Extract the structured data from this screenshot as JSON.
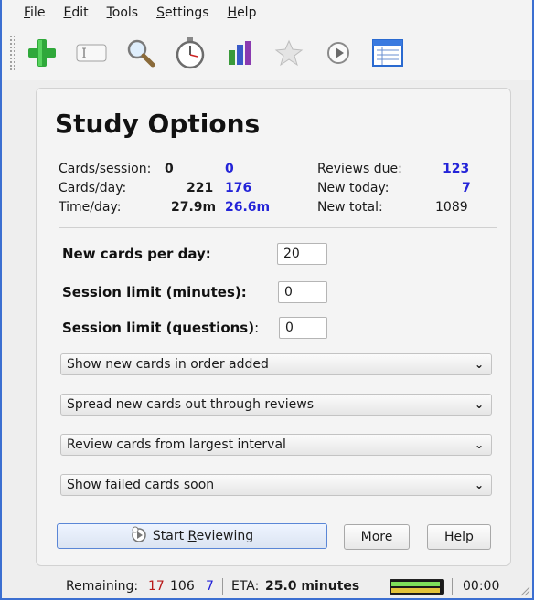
{
  "menu": {
    "file": "File",
    "edit": "Edit",
    "tools": "Tools",
    "settings": "Settings",
    "help": "Help"
  },
  "toolbar": {
    "icons": [
      "add-cards-icon",
      "card-field-icon",
      "search-icon",
      "timer-icon",
      "graph-icon",
      "star-icon",
      "play-icon",
      "card-list-icon"
    ]
  },
  "study": {
    "title": "Study Options",
    "stats": {
      "cards_session_label": "Cards/session:",
      "cards_session_val1": "0",
      "cards_session_val2": "0",
      "cards_day_label": "Cards/day:",
      "cards_day_val1": "221",
      "cards_day_val2": "176",
      "time_day_label": "Time/day:",
      "time_day_val1": "27.9m",
      "time_day_val2": "26.6m",
      "reviews_due_label": "Reviews due:",
      "reviews_due_val": "123",
      "new_today_label": "New today:",
      "new_today_val": "7",
      "new_total_label": "New total:",
      "new_total_val": "1089"
    },
    "options": {
      "new_per_day_label": "New cards per day:",
      "new_per_day_value": "20",
      "session_minutes_label": "Session limit (minutes):",
      "session_minutes_value": "0",
      "session_questions_label": "Session limit (questions)",
      "session_questions_colon": ":",
      "session_questions_value": "0"
    },
    "selects": {
      "new_order": "Show new cards in order added",
      "new_spread": "Spread new cards out through reviews",
      "review_order": "Review cards from largest interval",
      "failed_cards": "Show failed cards soon"
    },
    "buttons": {
      "start_prefix": "Start ",
      "start_underlined": "R",
      "start_suffix": "eviewing",
      "more": "More",
      "help": "Help"
    }
  },
  "status": {
    "remaining_label": "Remaining:",
    "remaining_failed": "17",
    "remaining_review": "106",
    "remaining_new": "7",
    "eta_label": "ETA:",
    "eta_value": "25.0 minutes",
    "timer": "00:00",
    "progress_green": 0.95,
    "progress_yellow": 0.95
  },
  "colors": {
    "accent_blue": "#2424d8",
    "failed_red": "#b81818",
    "window_border": "#3b6fd1"
  }
}
